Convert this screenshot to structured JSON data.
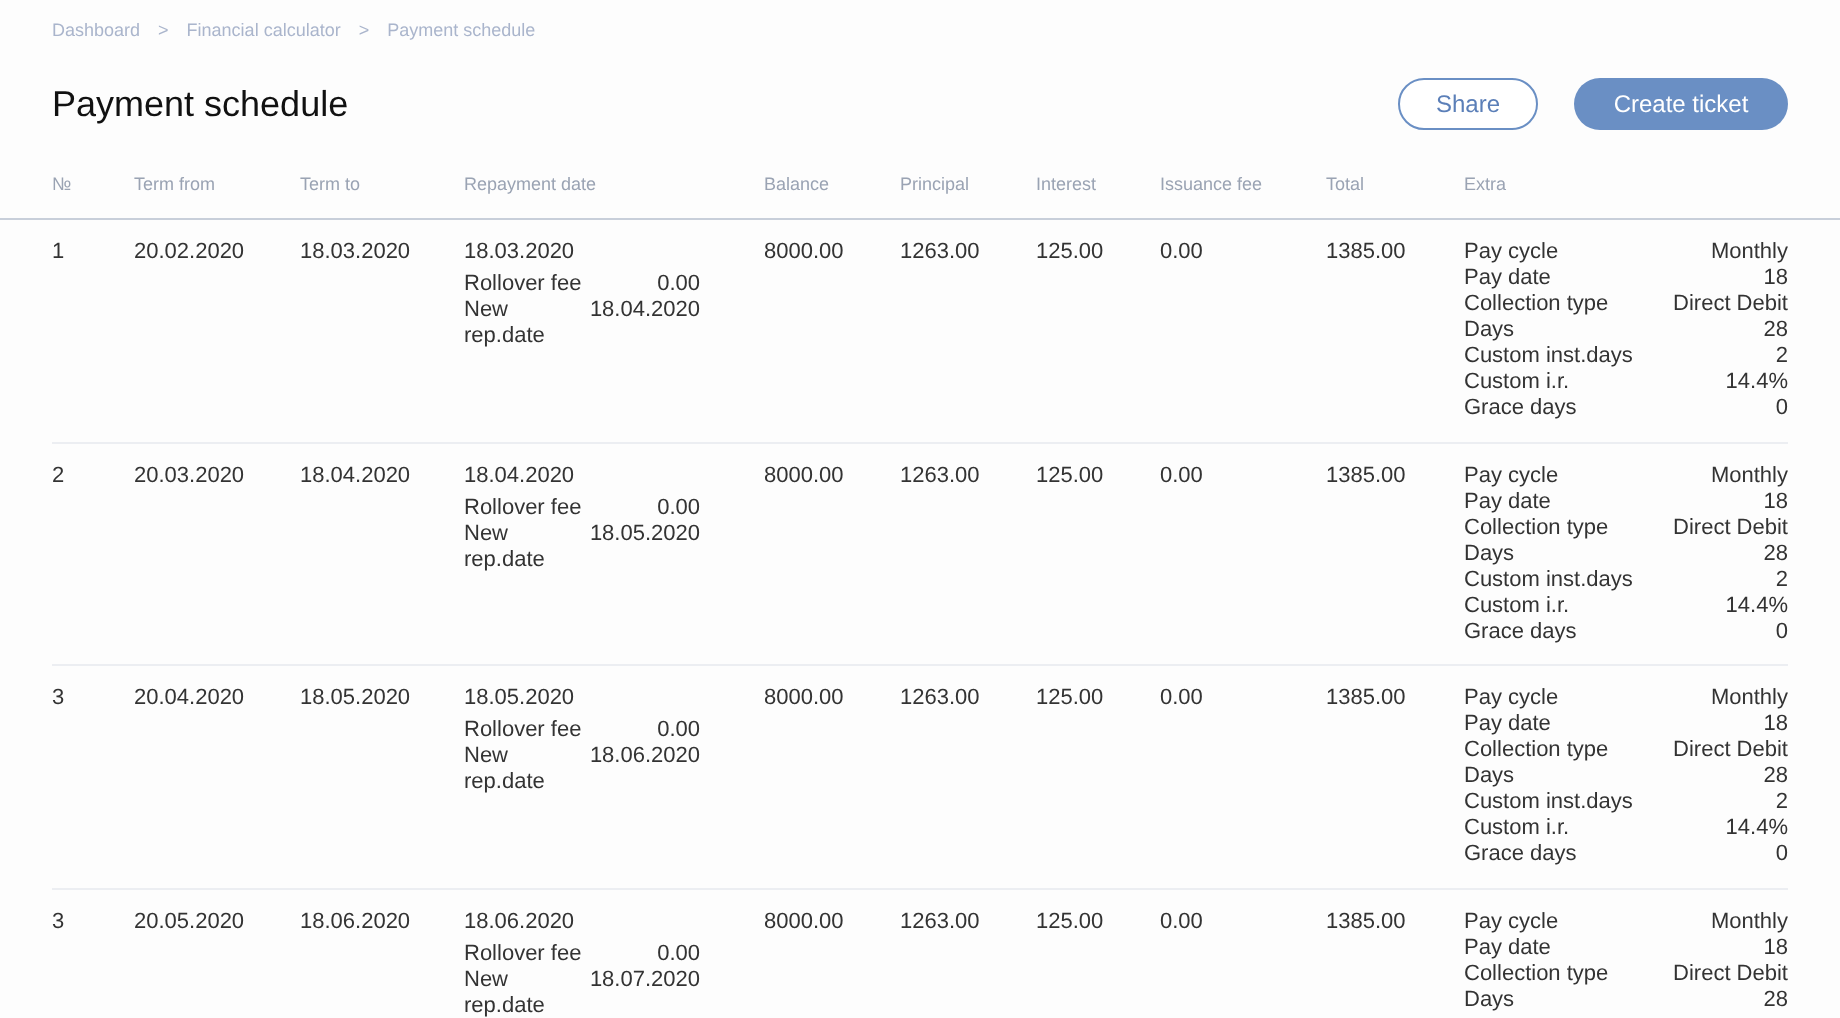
{
  "breadcrumbs": [
    {
      "label": "Dashboard"
    },
    {
      "label": "Financial calculator"
    },
    {
      "label": "Payment schedule"
    }
  ],
  "breadcrumb_separator": ">",
  "title": "Payment schedule",
  "buttons": [
    {
      "label": "Share",
      "kind": "outline"
    },
    {
      "label": "Create ticket",
      "kind": "primary"
    }
  ],
  "table": {
    "columns": [
      "№",
      "Term from",
      "Term to",
      "Repayment date",
      "Balance",
      "Principal",
      "Interest",
      "Issuance fee",
      "Total",
      "Extra"
    ],
    "rows": [
      {
        "no": "1",
        "term_from": "20.02.2020",
        "term_to": "18.03.2020",
        "repayment_date": "18.03.2020",
        "repayment_details": [
          {
            "label": "Rollover fee",
            "value": "0.00"
          },
          {
            "label": "New rep.date",
            "value": "18.04.2020"
          }
        ],
        "balance": "8000.00",
        "principal": "1263.00",
        "interest": "125.00",
        "issuance_fee": "0.00",
        "total": "1385.00",
        "extra": [
          {
            "label": "Pay cycle",
            "value": "Monthly"
          },
          {
            "label": "Pay date",
            "value": "18"
          },
          {
            "label": "Collection type",
            "value": "Direct Debit"
          },
          {
            "label": "Days",
            "value": "28"
          },
          {
            "label": "Custom inst.days",
            "value": "2"
          },
          {
            "label": "Custom i.r.",
            "value": "14.4%"
          },
          {
            "label": "Grace days",
            "value": "0"
          }
        ]
      },
      {
        "no": "2",
        "term_from": "20.03.2020",
        "term_to": "18.04.2020",
        "repayment_date": "18.04.2020",
        "repayment_details": [
          {
            "label": "Rollover fee",
            "value": "0.00"
          },
          {
            "label": "New rep.date",
            "value": "18.05.2020"
          }
        ],
        "balance": "8000.00",
        "principal": "1263.00",
        "interest": "125.00",
        "issuance_fee": "0.00",
        "total": "1385.00",
        "extra": [
          {
            "label": "Pay cycle",
            "value": "Monthly"
          },
          {
            "label": "Pay date",
            "value": "18"
          },
          {
            "label": "Collection type",
            "value": "Direct Debit"
          },
          {
            "label": "Days",
            "value": "28"
          },
          {
            "label": "Custom inst.days",
            "value": "2"
          },
          {
            "label": "Custom i.r.",
            "value": "14.4%"
          },
          {
            "label": "Grace days",
            "value": "0"
          }
        ]
      },
      {
        "no": "3",
        "term_from": "20.04.2020",
        "term_to": "18.05.2020",
        "repayment_date": "18.05.2020",
        "repayment_details": [
          {
            "label": "Rollover fee",
            "value": "0.00"
          },
          {
            "label": "New rep.date",
            "value": "18.06.2020"
          }
        ],
        "balance": "8000.00",
        "principal": "1263.00",
        "interest": "125.00",
        "issuance_fee": "0.00",
        "total": "1385.00",
        "extra": [
          {
            "label": "Pay cycle",
            "value": "Monthly"
          },
          {
            "label": "Pay date",
            "value": "18"
          },
          {
            "label": "Collection type",
            "value": "Direct Debit"
          },
          {
            "label": "Days",
            "value": "28"
          },
          {
            "label": "Custom inst.days",
            "value": "2"
          },
          {
            "label": "Custom i.r.",
            "value": "14.4%"
          },
          {
            "label": "Grace days",
            "value": "0"
          }
        ]
      },
      {
        "no": "3",
        "term_from": "20.05.2020",
        "term_to": "18.06.2020",
        "repayment_date": "18.06.2020",
        "repayment_details": [
          {
            "label": "Rollover fee",
            "value": "0.00"
          },
          {
            "label": "New rep.date",
            "value": "18.07.2020"
          }
        ],
        "balance": "8000.00",
        "principal": "1263.00",
        "interest": "125.00",
        "issuance_fee": "0.00",
        "total": "1385.00",
        "extra": [
          {
            "label": "Pay cycle",
            "value": "Monthly"
          },
          {
            "label": "Pay date",
            "value": "18"
          },
          {
            "label": "Collection type",
            "value": "Direct Debit"
          },
          {
            "label": "Days",
            "value": "28"
          }
        ]
      }
    ]
  }
}
